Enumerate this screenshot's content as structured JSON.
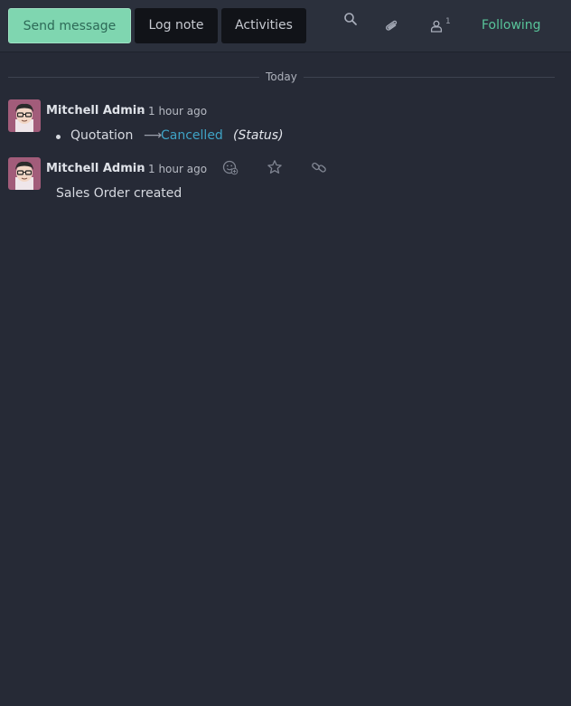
{
  "composer": {
    "send_message": "Send message",
    "log_note": "Log note",
    "activities": "Activities"
  },
  "toolbar": {
    "icons": [
      "search-icon",
      "paperclip-icon",
      "user-icon"
    ],
    "follower_count": "1",
    "following": "Following"
  },
  "thread": {
    "date_separator": "Today",
    "messages": [
      {
        "author": "Mitchell Admin",
        "separator": "-",
        "time": "1 hour ago",
        "tracking": {
          "old_value": "Quotation",
          "arrow": "⟶",
          "new_value": "Cancelled",
          "field_name": "(Status)"
        }
      },
      {
        "author": "Mitchell Admin",
        "separator": "-",
        "time": "1 hour ago",
        "body": "Sales Order created",
        "actions": [
          "add-reaction-icon",
          "star-icon",
          "link-icon"
        ]
      }
    ]
  },
  "colors": {
    "background": "#262a36",
    "topbar": "#2b303c",
    "primary_button": "#7fd6b0",
    "following": "#58c49a",
    "tracking_new_value": "#3fa3c6"
  }
}
